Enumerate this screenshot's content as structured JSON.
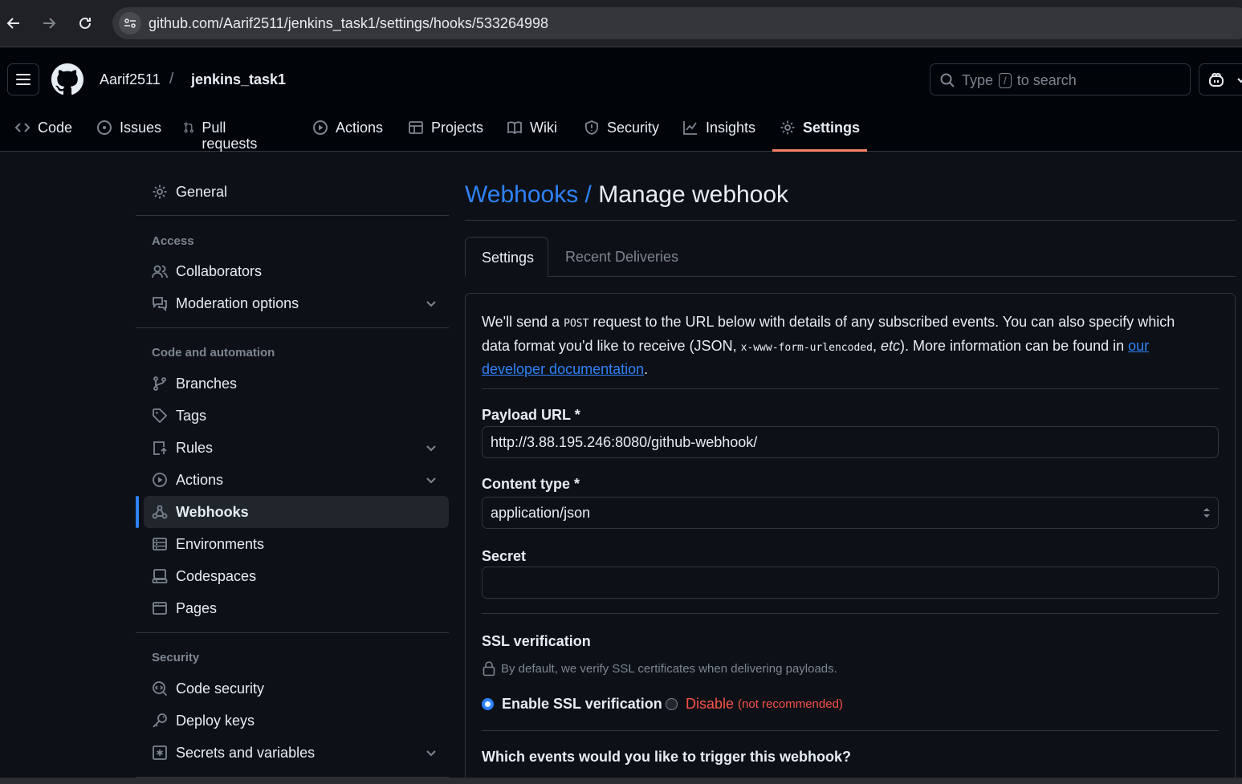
{
  "browser": {
    "url": "github.com/Aarif2511/jenkins_task1/settings/hooks/533264998"
  },
  "header": {
    "owner": "Aarif2511",
    "separator": "/",
    "repo": "jenkins_task1",
    "search": {
      "prefix": "Type",
      "key": "/",
      "suffix": "to search"
    }
  },
  "repo_tabs": [
    {
      "label": "Code",
      "icon": "code-icon"
    },
    {
      "label": "Issues",
      "icon": "issue-icon"
    },
    {
      "label": "Pull requests",
      "icon": "pull-request-icon"
    },
    {
      "label": "Actions",
      "icon": "play-icon"
    },
    {
      "label": "Projects",
      "icon": "table-icon"
    },
    {
      "label": "Wiki",
      "icon": "book-icon"
    },
    {
      "label": "Security",
      "icon": "shield-icon"
    },
    {
      "label": "Insights",
      "icon": "graph-icon"
    },
    {
      "label": "Settings",
      "icon": "gear-icon",
      "active": true
    }
  ],
  "sidebar": {
    "general": "General",
    "access_heading": "Access",
    "collaborators": "Collaborators",
    "moderation": "Moderation options",
    "code_heading": "Code and automation",
    "branches": "Branches",
    "tags": "Tags",
    "rules": "Rules",
    "actions": "Actions",
    "webhooks": "Webhooks",
    "environments": "Environments",
    "codespaces": "Codespaces",
    "pages": "Pages",
    "security_heading": "Security",
    "code_security": "Code security",
    "deploy_keys": "Deploy keys",
    "secrets": "Secrets and variables"
  },
  "main": {
    "breadcrumb": "Webhooks /",
    "title": "Manage webhook",
    "tabs": {
      "settings": "Settings",
      "deliveries": "Recent Deliveries"
    },
    "intro": {
      "p1": "We'll send a ",
      "code1": "POST",
      "p2": " request to the URL below with details of any subscribed events. You can also specify which data format you'd like to receive (JSON, ",
      "code2": "x-www-form-urlencoded",
      "p3": ", ",
      "etc": "etc",
      "p4": "). More information can be found in ",
      "link": "our developer documentation",
      "p5": "."
    },
    "payload_label": "Payload URL *",
    "payload_value": "http://3.88.195.246:8080/github-webhook/",
    "content_type_label": "Content type *",
    "content_type_value": "application/json",
    "secret_label": "Secret",
    "secret_value": "",
    "ssl_heading": "SSL verification",
    "ssl_note": "By default, we verify SSL certificates when delivering payloads.",
    "ssl_enable": "Enable SSL verification",
    "ssl_disable": "Disable",
    "ssl_disable_note": "(not recommended)",
    "events_question": "Which events would you like to trigger this webhook?"
  },
  "colors": {
    "accent": "#2f81f7",
    "danger": "#f85149",
    "tab_underline": "#f78166",
    "background": "#0d1117"
  }
}
